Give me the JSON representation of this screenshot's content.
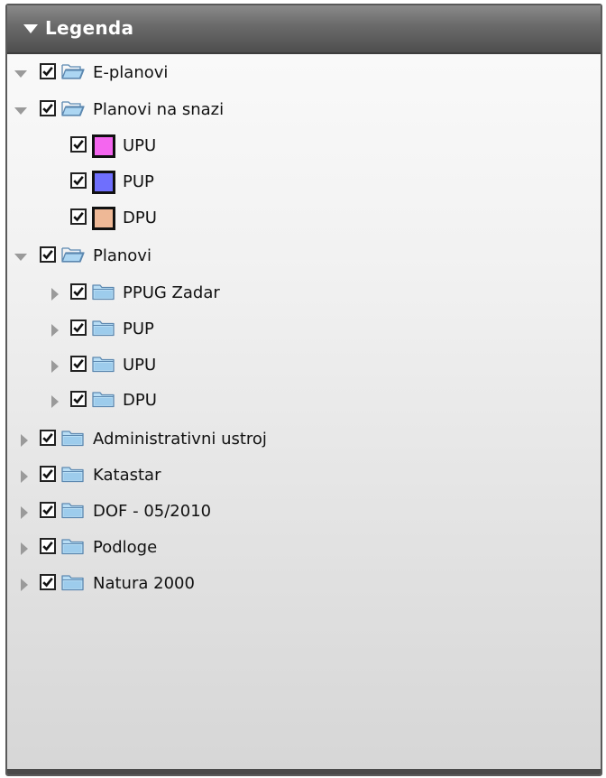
{
  "panel": {
    "title": "Legenda",
    "toggle_icon": "triangle-down-icon"
  },
  "tree": {
    "e_planovi": {
      "label": "E-planovi",
      "checked": true,
      "expanded": true,
      "icon": "folder-open-icon"
    },
    "planovi_na_snazi": {
      "label": "Planovi na snazi",
      "checked": true,
      "expanded": true,
      "icon": "folder-open-icon",
      "children": [
        {
          "label": "UPU",
          "checked": true,
          "color": "#f466ef"
        },
        {
          "label": "PUP",
          "checked": true,
          "color": "#6f6ffd"
        },
        {
          "label": "DPU",
          "checked": true,
          "color": "#eeb896"
        }
      ]
    },
    "planovi": {
      "label": "Planovi",
      "checked": true,
      "expanded": true,
      "icon": "folder-open-icon",
      "children": [
        {
          "label": "PPUG Zadar",
          "checked": true,
          "expanded": false,
          "icon": "folder-closed-icon"
        },
        {
          "label": "PUP",
          "checked": true,
          "expanded": false,
          "icon": "folder-closed-icon"
        },
        {
          "label": "UPU",
          "checked": true,
          "expanded": false,
          "icon": "folder-closed-icon"
        },
        {
          "label": "DPU",
          "checked": true,
          "expanded": false,
          "icon": "folder-closed-icon"
        }
      ]
    },
    "top_folders": [
      {
        "label": "Administrativni ustroj",
        "checked": true,
        "expanded": false,
        "icon": "folder-closed-icon"
      },
      {
        "label": "Katastar",
        "checked": true,
        "expanded": false,
        "icon": "folder-closed-icon"
      },
      {
        "label": "DOF - 05/2010",
        "checked": true,
        "expanded": false,
        "icon": "folder-closed-icon"
      },
      {
        "label": "Podloge",
        "checked": true,
        "expanded": false,
        "icon": "folder-closed-icon"
      },
      {
        "label": "Natura 2000",
        "checked": true,
        "expanded": false,
        "icon": "folder-closed-icon"
      }
    ]
  },
  "colors": {
    "header_dark": "#4e4e4e",
    "folder_blue": "#a9d3ef"
  }
}
